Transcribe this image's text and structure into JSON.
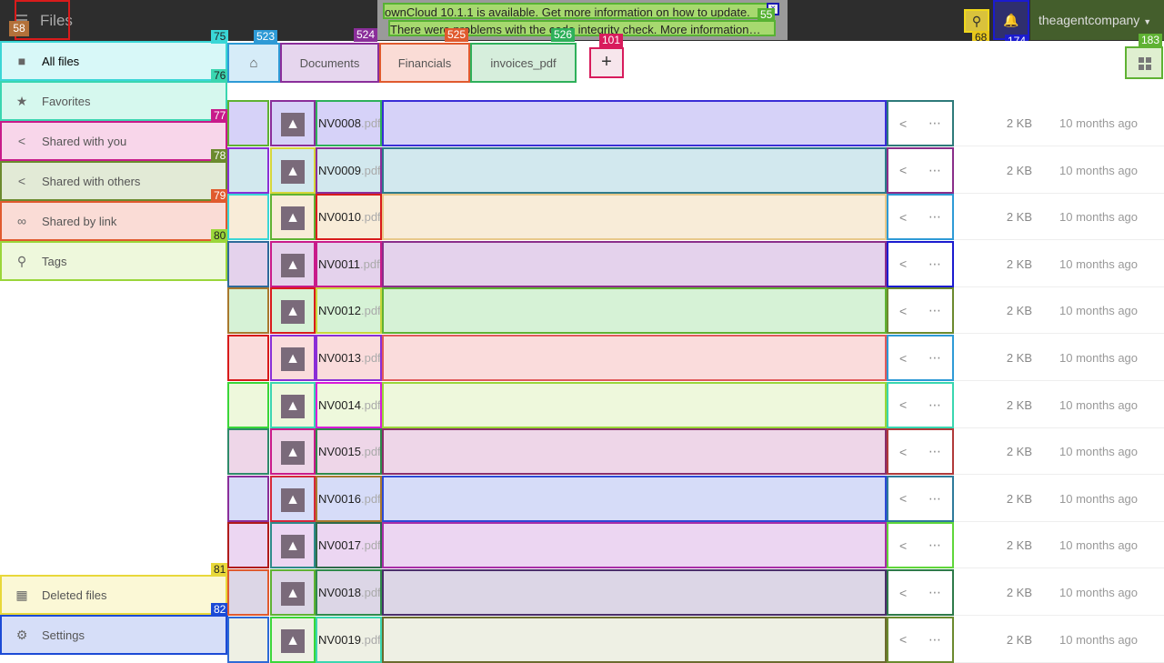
{
  "header": {
    "app_title": "Files",
    "menu_badge": "58",
    "notification_line1": "ownCloud 10.1.1 is available. Get more information on how to update.",
    "notification_line2": "There were problems with the code integrity check. More information…",
    "notification_close": "×",
    "user_name": "theagentcompany"
  },
  "sidebar": {
    "items": [
      {
        "label": "All files",
        "icon": "folder-icon"
      },
      {
        "label": "Favorites",
        "icon": "star-icon"
      },
      {
        "label": "Shared with you",
        "icon": "share-icon"
      },
      {
        "label": "Shared with others",
        "icon": "share-icon"
      },
      {
        "label": "Shared by link",
        "icon": "link-icon"
      },
      {
        "label": "Tags",
        "icon": "tag-icon"
      }
    ],
    "deleted_files": "Deleted files",
    "settings": "Settings"
  },
  "breadcrumb": {
    "items": [
      "Documents",
      "Financials",
      "invoices_pdf"
    ]
  },
  "new_button": "+",
  "files": [
    {
      "name": "NV0008",
      "ext": ".pdf",
      "size": "2 KB",
      "modified": "10 months ago"
    },
    {
      "name": "NV0009",
      "ext": ".pdf",
      "size": "2 KB",
      "modified": "10 months ago"
    },
    {
      "name": "NV0010",
      "ext": ".pdf",
      "size": "2 KB",
      "modified": "10 months ago"
    },
    {
      "name": "NV0011",
      "ext": ".pdf",
      "size": "2 KB",
      "modified": "10 months ago"
    },
    {
      "name": "NV0012",
      "ext": ".pdf",
      "size": "2 KB",
      "modified": "10 months ago"
    },
    {
      "name": "NV0013",
      "ext": ".pdf",
      "size": "2 KB",
      "modified": "10 months ago"
    },
    {
      "name": "NV0014",
      "ext": ".pdf",
      "size": "2 KB",
      "modified": "10 months ago"
    },
    {
      "name": "NV0015",
      "ext": ".pdf",
      "size": "2 KB",
      "modified": "10 months ago"
    },
    {
      "name": "NV0016",
      "ext": ".pdf",
      "size": "2 KB",
      "modified": "10 months ago"
    },
    {
      "name": "NV0017",
      "ext": ".pdf",
      "size": "2 KB",
      "modified": "10 months ago"
    },
    {
      "name": "NV0018",
      "ext": ".pdf",
      "size": "2 KB",
      "modified": "10 months ago"
    },
    {
      "name": "NV0019",
      "ext": ".pdf",
      "size": "2 KB",
      "modified": "10 months ago"
    }
  ],
  "overlay_tags": {
    "sidebar": [
      "75",
      "76",
      "77",
      "78",
      "79",
      "80",
      "81",
      "82"
    ],
    "crumbs": [
      "523",
      "524",
      "525",
      "526"
    ],
    "new_button": "101",
    "view_toggle": "183",
    "search": "68",
    "bell": "174",
    "notification": "55"
  },
  "colors": {
    "header_bg": "#2d2d2d",
    "accent_pdf": "#7a6a7a"
  }
}
